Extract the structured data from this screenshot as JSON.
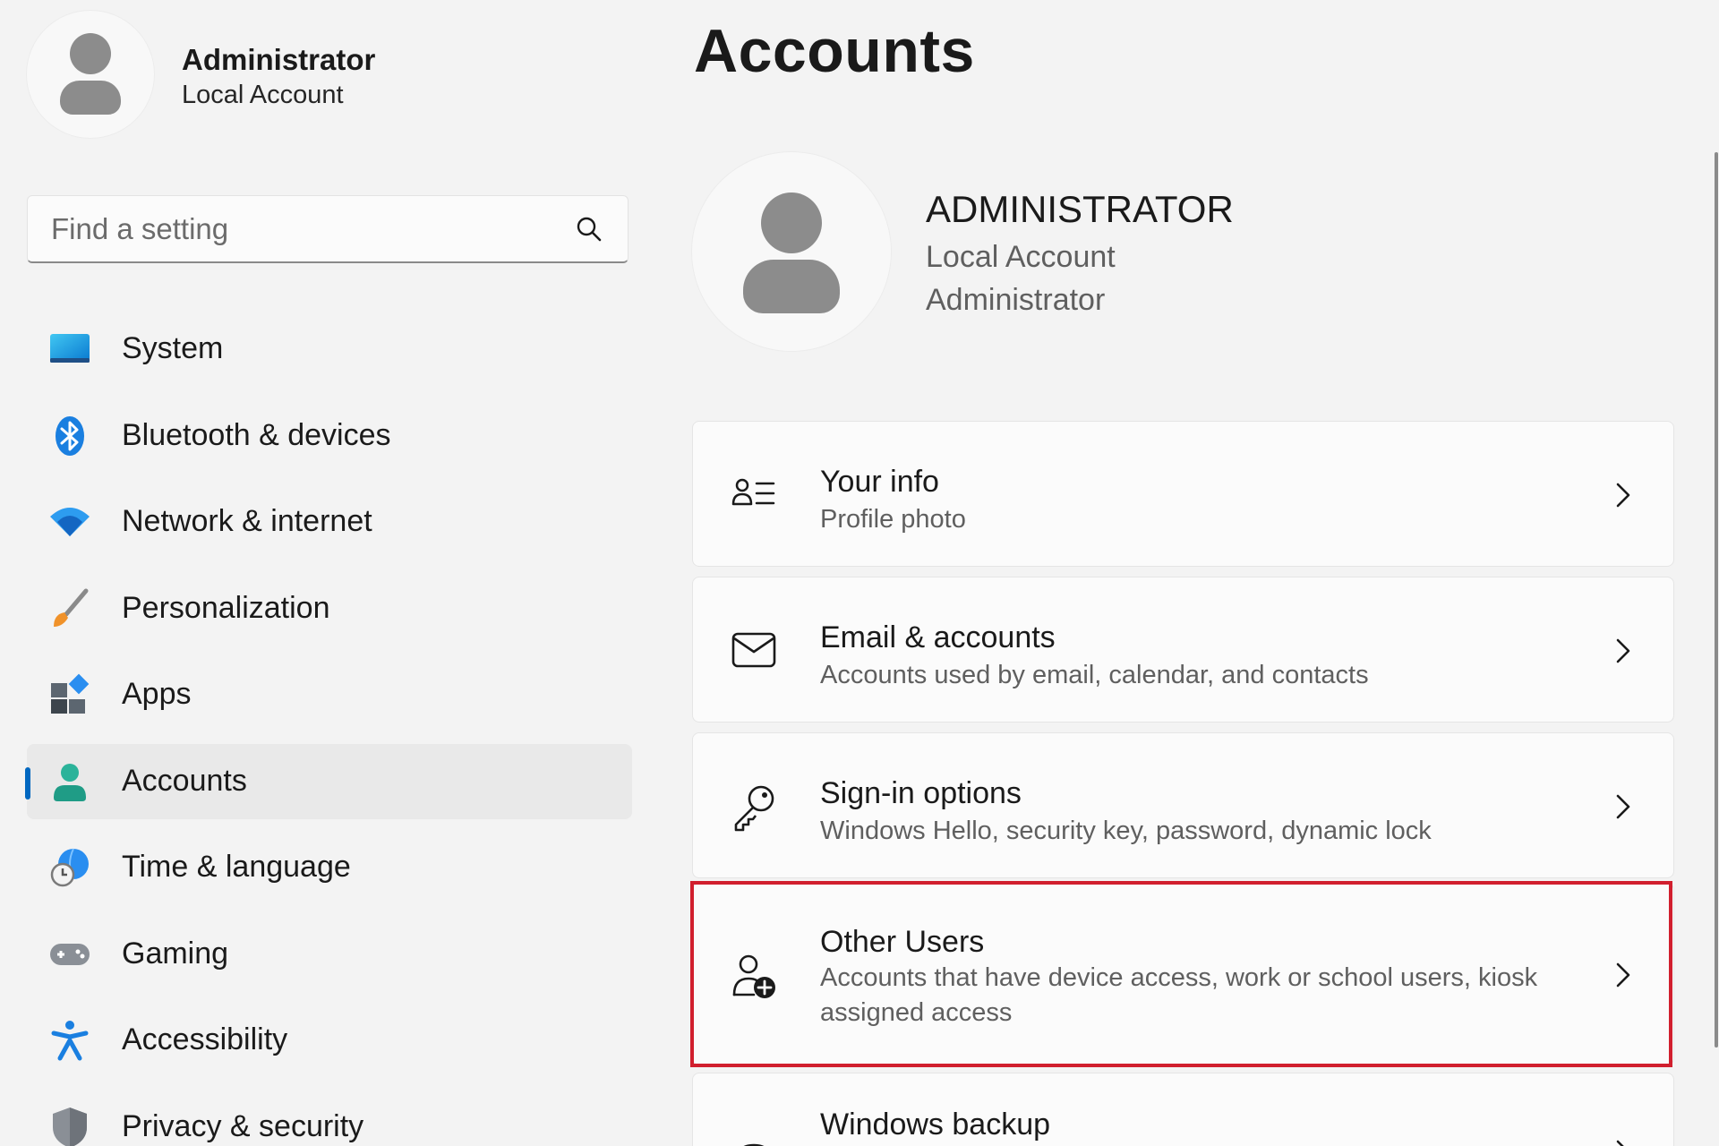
{
  "user": {
    "name": "Administrator",
    "type": "Local Account"
  },
  "search": {
    "placeholder": "Find a setting",
    "value": ""
  },
  "nav": {
    "items": [
      {
        "label": "System",
        "icon": "monitor-icon"
      },
      {
        "label": "Bluetooth & devices",
        "icon": "bluetooth-icon"
      },
      {
        "label": "Network & internet",
        "icon": "wifi-icon"
      },
      {
        "label": "Personalization",
        "icon": "paintbrush-icon"
      },
      {
        "label": "Apps",
        "icon": "apps-icon"
      },
      {
        "label": "Accounts",
        "icon": "person-icon",
        "selected": true
      },
      {
        "label": "Time & language",
        "icon": "globe-clock-icon"
      },
      {
        "label": "Gaming",
        "icon": "gamepad-icon"
      },
      {
        "label": "Accessibility",
        "icon": "accessibility-icon"
      },
      {
        "label": "Privacy & security",
        "icon": "shield-icon"
      }
    ]
  },
  "main": {
    "title": "Accounts",
    "profile": {
      "name": "ADMINISTRATOR",
      "line1": "Local Account",
      "line2": "Administrator"
    },
    "cards": [
      {
        "title": "Your info",
        "description": "Profile photo",
        "icon": "person-list-icon"
      },
      {
        "title": "Email & accounts",
        "description": "Accounts used by email, calendar, and contacts",
        "icon": "mail-icon"
      },
      {
        "title": "Sign-in options",
        "description": "Windows Hello, security key, password, dynamic lock",
        "icon": "key-icon"
      },
      {
        "title": "Other Users",
        "description": "Accounts that have device access, work or school users, kiosk assigned access",
        "icon": "person-add-icon",
        "highlighted": true
      },
      {
        "title": "Windows backup",
        "description": "",
        "icon": "backup-icon"
      }
    ]
  },
  "colors": {
    "accent": "#0067c0",
    "highlight_border": "#d11f2e",
    "background": "#f3f3f3"
  }
}
